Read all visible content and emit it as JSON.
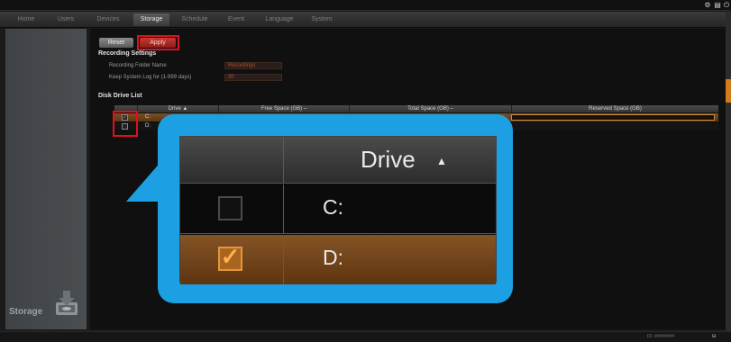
{
  "topbar": {
    "icons": [
      "settings-icon",
      "document-icon",
      "power-icon"
    ]
  },
  "tabs": [
    "Home",
    "Users",
    "Devices",
    "Storage",
    "Schedule",
    "Event",
    "Language",
    "System"
  ],
  "active_tab": "Storage",
  "toolbar": {
    "reset_label": "Reset",
    "apply_label": "Apply"
  },
  "recording_settings": {
    "heading": "Recording Settings",
    "folder_label": "Recording Folder Name",
    "folder_value": "Recordings",
    "log_label": "Keep System Log for (1-999 days)",
    "log_value": "30"
  },
  "disk_list": {
    "heading": "Disk Drive List",
    "columns": [
      "Drive ▲",
      "Free Space (GB) –",
      "Total Space (GB) –",
      "Reserved Space (GB)"
    ],
    "rows": [
      {
        "drive": "C:",
        "checked": true,
        "selected": true
      },
      {
        "drive": "D:",
        "checked": false,
        "selected": false
      }
    ]
  },
  "zoom": {
    "header": "Drive",
    "sort_icon": "sort-ascending-icon",
    "rows": [
      {
        "drive": "C:",
        "checked": false
      },
      {
        "drive": "D:",
        "checked": true
      }
    ]
  },
  "sidebar": {
    "label": "Storage",
    "icon": "storage-icon"
  },
  "statusbar": {
    "right_text": "IO: ########"
  },
  "colors": {
    "accent_orange": "#d27a1c",
    "highlight_red": "#e01020",
    "callout_blue": "#1da0e3",
    "selected_row": "#7a4f22"
  }
}
